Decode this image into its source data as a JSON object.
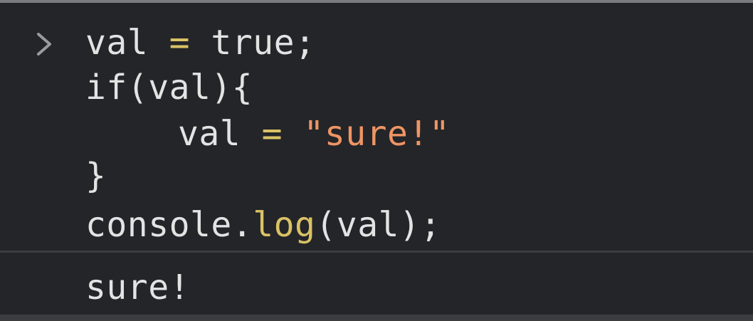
{
  "console": {
    "prompt_icon": "chevron-right-icon",
    "input": {
      "line1": {
        "var": "val",
        "op": "=",
        "value": "true",
        "end": ";"
      },
      "line2": {
        "text": "if(val){"
      },
      "line3": {
        "var": "val",
        "op": "=",
        "string": "\"sure!\""
      },
      "line4": {
        "text": "}"
      },
      "line5": {
        "obj": "console.",
        "fn": "log",
        "args": "(val);"
      }
    },
    "output": {
      "text": "sure!"
    }
  },
  "colors": {
    "background": "#242528",
    "text": "#e2e4e3",
    "operator": "#dac266",
    "string": "#ef9565",
    "prompt": "#9a9b9e"
  }
}
